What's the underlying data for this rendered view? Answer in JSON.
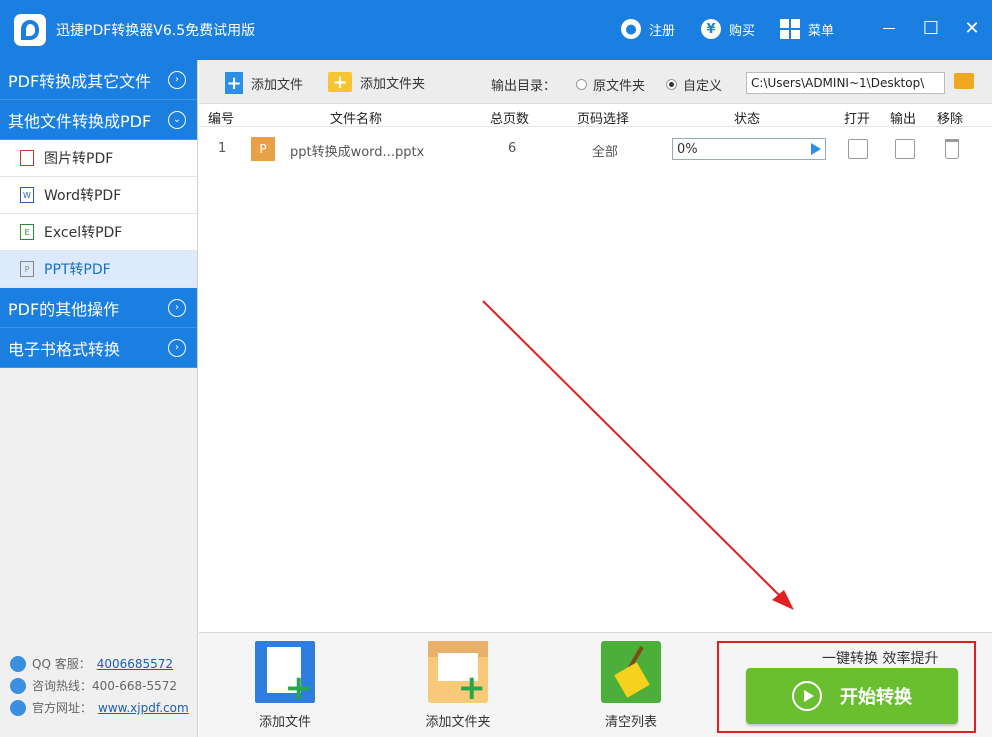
{
  "window": {
    "title": "迅捷PDF转换器V6.5免费试用版",
    "register": "注册",
    "buy": "购买",
    "menu": "菜单",
    "min_glyph": "—",
    "max_glyph": "☐",
    "close_glyph": "✕"
  },
  "sidebar": {
    "sections": [
      {
        "label": "PDF转换成其它文件",
        "chevron": "›"
      },
      {
        "label": "其他文件转换成PDF",
        "chevron": "⌄"
      },
      {
        "label": "PDF的其他操作",
        "chevron": "›"
      },
      {
        "label": "电子书格式转换",
        "chevron": "›"
      }
    ],
    "items": [
      {
        "label": "图片转PDF"
      },
      {
        "label": "Word转PDF"
      },
      {
        "label": "Excel转PDF"
      },
      {
        "label": "PPT转PDF"
      }
    ],
    "footer": {
      "qq_label": "QQ 客服：",
      "qq": "4006685572",
      "hotline": "咨询热线：400-668-5572",
      "site_label": "官方网址：",
      "site": "www.xjpdf.com"
    }
  },
  "toolbar": {
    "add_file": "添加文件",
    "add_folder": "添加文件夹",
    "output_dir": "输出目录：",
    "opt_original": "原文件夹",
    "opt_custom": "自定义",
    "path": "C:\\Users\\ADMINI~1\\Desktop\\"
  },
  "table": {
    "headers": [
      "编号",
      "文件名称",
      "总页数",
      "页码选择",
      "状态",
      "打开",
      "输出",
      "移除"
    ],
    "rows": [
      {
        "num": "1",
        "icon_letter": "P",
        "name": "ppt转换成word...pptx",
        "pages": "6",
        "range": "全部",
        "progress": "0%",
        "progress_value": 0
      }
    ]
  },
  "bottom": {
    "add_file": "添加文件",
    "add_folder": "添加文件夹",
    "clear": "清空列表",
    "slogan": "一键转换  效率提升",
    "start": "开始转换"
  },
  "colors": {
    "brand_blue": "#1a7fe0",
    "start_green": "#69bf2f",
    "highlight_red": "#e02020"
  }
}
